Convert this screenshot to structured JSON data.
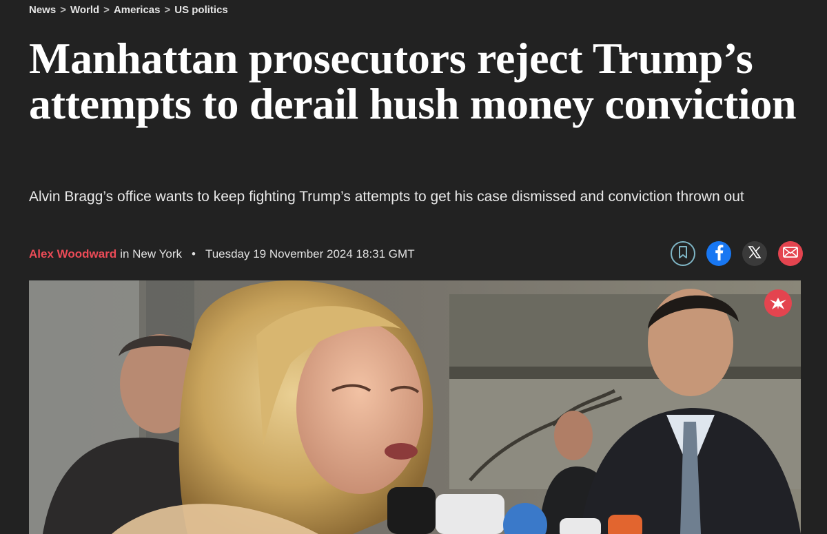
{
  "breadcrumb": {
    "items": [
      "News",
      "World",
      "Americas",
      "US politics"
    ],
    "separator": ">"
  },
  "article": {
    "headline": "Manhattan prosecutors reject Trump’s attempts to derail hush money conviction",
    "standfirst": "Alvin Bragg’s office wants to keep fighting Trump’s attempts to get his case dismissed and conviction thrown out",
    "author": "Alex Woodward",
    "location": "in New York",
    "separator_dot": "•",
    "timestamp": "Tuesday 19 November 2024 18:31 GMT"
  },
  "share": {
    "icons": [
      "bookmark-icon",
      "facebook-icon",
      "x-icon",
      "email-icon"
    ]
  },
  "colors": {
    "background": "#222222",
    "author_accent": "#ec4b57",
    "facebook": "#1877f2",
    "email": "#e4444f",
    "bookmark_ring": "#7fb6c6"
  }
}
